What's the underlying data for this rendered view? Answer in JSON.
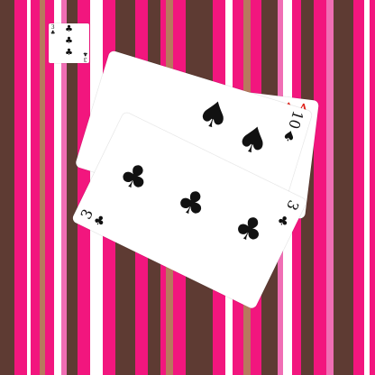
{
  "background": {
    "colors": {
      "magenta": "#f2167e",
      "brown": "#5e3b33",
      "tan": "#b8785e",
      "pink": "#f06eb4",
      "white": "#ffffff"
    }
  },
  "deck_card": {
    "rank": "3",
    "suit": "♣",
    "suit_name": "clubs",
    "color": "#111111"
  },
  "hand": [
    {
      "id": "ace-of-diamonds",
      "rank": "A",
      "suit": "♦",
      "suit_name": "diamonds",
      "color": "#e0241c"
    },
    {
      "id": "ten-of-spades",
      "rank": "10",
      "suit": "♠",
      "suit_name": "spades",
      "color": "#111111"
    },
    {
      "id": "three-of-clubs",
      "rank": "3",
      "suit": "♣",
      "suit_name": "clubs",
      "color": "#111111"
    }
  ]
}
